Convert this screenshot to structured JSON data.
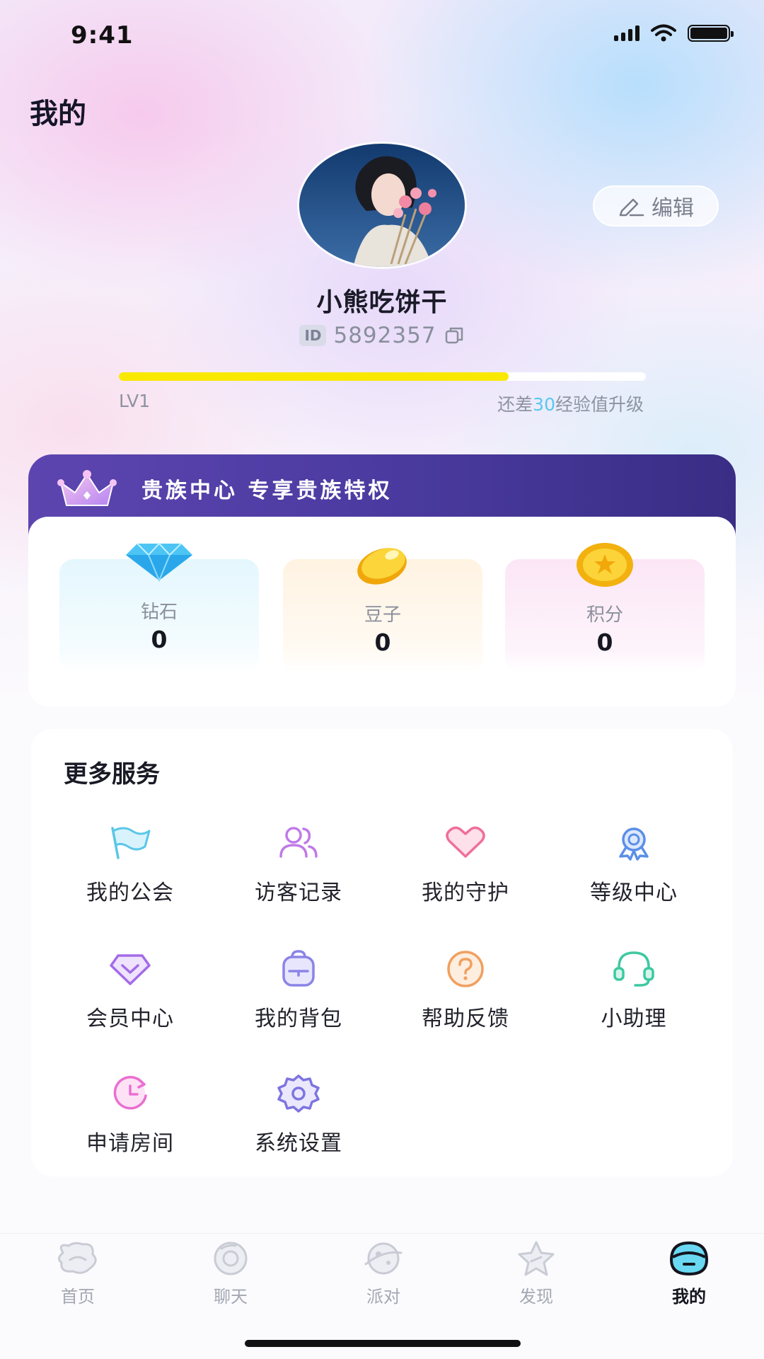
{
  "status_bar": {
    "time": "9:41"
  },
  "page_title": "我的",
  "profile": {
    "edit_label": "编辑",
    "username": "小熊吃饼干",
    "id_badge": "ID",
    "id_number": "5892357",
    "level": "LV1",
    "level_progress": 0.74,
    "level_hint_prefix": "还差",
    "level_hint_value": "30",
    "level_hint_suffix": "经验值升级"
  },
  "vip_banner": {
    "text": "贵族中心  专享贵族特权"
  },
  "wallet": [
    {
      "label": "钻石",
      "value": "0",
      "icon": "diamond-icon"
    },
    {
      "label": "豆子",
      "value": "0",
      "icon": "bean-icon"
    },
    {
      "label": "积分",
      "value": "0",
      "icon": "coin-icon"
    }
  ],
  "services": {
    "title": "更多服务",
    "items": [
      {
        "label": "我的公会",
        "icon": "flag-icon",
        "color": "#5bc6e8"
      },
      {
        "label": "访客记录",
        "icon": "users-icon",
        "color": "#c07ae8"
      },
      {
        "label": "我的守护",
        "icon": "heart-icon",
        "color": "#ef6f9a"
      },
      {
        "label": "等级中心",
        "icon": "badge-icon",
        "color": "#5b8fe8"
      },
      {
        "label": "会员中心",
        "icon": "vip-gem-icon",
        "color": "#a36be8"
      },
      {
        "label": "我的背包",
        "icon": "backpack-icon",
        "color": "#8b84e8"
      },
      {
        "label": "帮助反馈",
        "icon": "help-icon",
        "color": "#f0a060"
      },
      {
        "label": "小助理",
        "icon": "headset-icon",
        "color": "#3ec9a0"
      },
      {
        "label": "申请房间",
        "icon": "clock-icon",
        "color": "#ea6fd0"
      },
      {
        "label": "系统设置",
        "icon": "gear-icon",
        "color": "#7e74e0"
      }
    ]
  },
  "tabbar": [
    {
      "label": "首页",
      "icon": "home-planet-icon",
      "active": false
    },
    {
      "label": "聊天",
      "icon": "chat-planet-icon",
      "active": false
    },
    {
      "label": "派对",
      "icon": "party-planet-icon",
      "active": false
    },
    {
      "label": "发现",
      "icon": "star-icon",
      "active": false
    },
    {
      "label": "我的",
      "icon": "profile-face-icon",
      "active": true
    }
  ]
}
